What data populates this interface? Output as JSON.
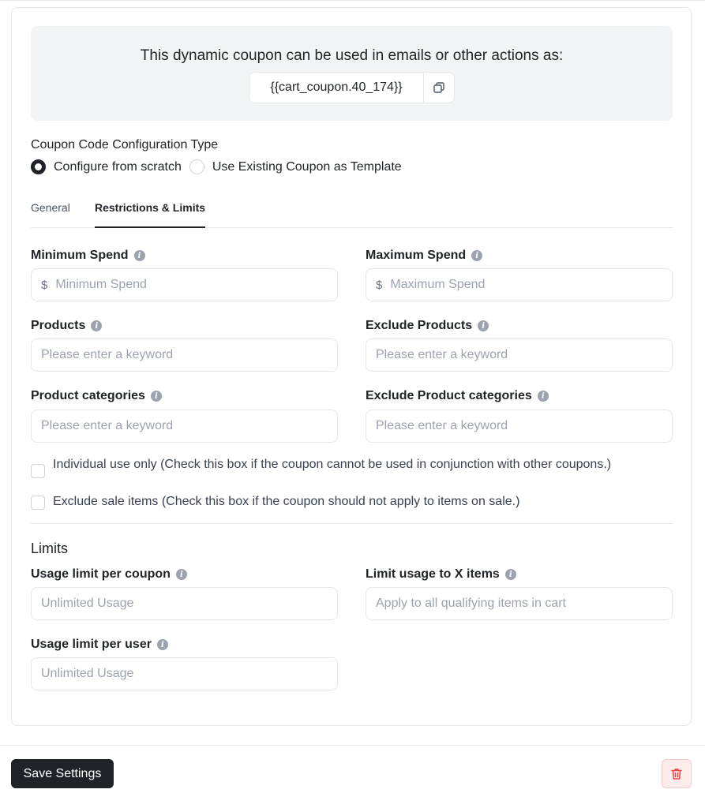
{
  "banner": {
    "text": "This dynamic coupon can be used in emails or other actions as:",
    "code": "{{cart_coupon.40_174}}",
    "copy_icon": "copy-icon"
  },
  "config_type": {
    "label": "Coupon Code Configuration Type",
    "options": [
      {
        "label": "Configure from scratch",
        "checked": true
      },
      {
        "label": "Use Existing Coupon as Template",
        "checked": false
      }
    ]
  },
  "tabs": [
    {
      "label": "General",
      "active": false
    },
    {
      "label": "Restrictions & Limits",
      "active": true
    }
  ],
  "restrictions": {
    "min_spend": {
      "label": "Minimum Spend",
      "prefix": "$",
      "placeholder": "Minimum Spend"
    },
    "max_spend": {
      "label": "Maximum Spend",
      "prefix": "$",
      "placeholder": "Maximum Spend"
    },
    "products": {
      "label": "Products",
      "placeholder": "Please enter a keyword"
    },
    "exclude_products": {
      "label": "Exclude Products",
      "placeholder": "Please enter a keyword"
    },
    "product_categories": {
      "label": "Product categories",
      "placeholder": "Please enter a keyword"
    },
    "exclude_product_categories": {
      "label": "Exclude Product categories",
      "placeholder": "Please enter a keyword"
    },
    "individual_use": {
      "label": "Individual use only (Check this box if the coupon cannot be used in conjunction with other coupons.)",
      "checked": false
    },
    "exclude_sale": {
      "label": "Exclude sale items (Check this box if the coupon should not apply to items on sale.)",
      "checked": false
    }
  },
  "limits": {
    "title": "Limits",
    "per_coupon": {
      "label": "Usage limit per coupon",
      "placeholder": "Unlimited Usage"
    },
    "x_items": {
      "label": "Limit usage to X items",
      "placeholder": "Apply to all qualifying items in cart"
    },
    "per_user": {
      "label": "Usage limit per user",
      "placeholder": "Unlimited Usage"
    }
  },
  "info_glyph": "i",
  "footer": {
    "save_label": "Save Settings",
    "delete_icon": "trash-icon"
  },
  "colors": {
    "primary": "#1f2328",
    "banner_bg": "#f3f4f6",
    "danger": "#e5484d",
    "danger_bg": "#fdecec"
  }
}
